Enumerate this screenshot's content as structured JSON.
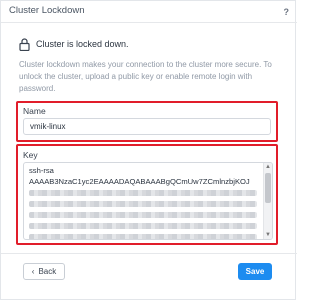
{
  "dialog": {
    "title": "Cluster Lockdown",
    "help": "?"
  },
  "lock": {
    "status": "Cluster is locked down.",
    "icon": "lock-icon"
  },
  "description": "Cluster lockdown makes your connection to the cluster more secure. To unlock the cluster, upload a public key or enable remote login with password.",
  "name_field": {
    "label": "Name",
    "value": "vmik-linux"
  },
  "key_field": {
    "label": "Key",
    "line1": "ssh-rsa",
    "line2": "AAAAB3NzaC1yc2EAAAADAQABAAABgQCmUw7ZCmlnzbjKOJ"
  },
  "footer": {
    "back_label": "Back",
    "save_label": "Save"
  },
  "colors": {
    "highlight": "#e11d2a",
    "primary": "#1d8cf0"
  }
}
